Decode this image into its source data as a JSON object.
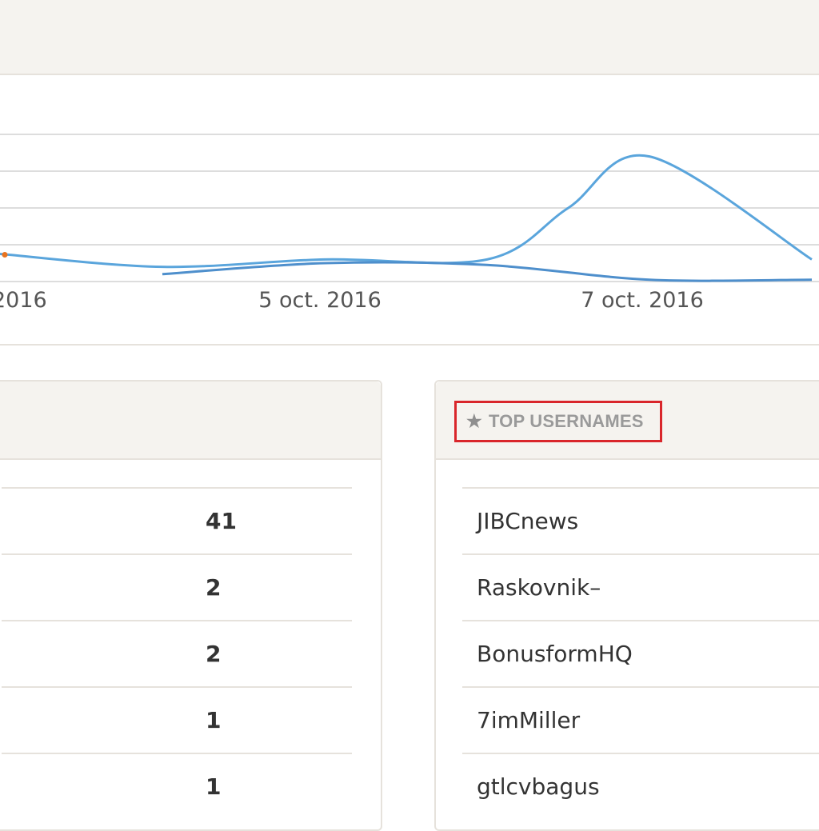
{
  "chart_data": {
    "type": "line",
    "x_tick_labels": [
      "2016",
      "5 oct. 2016",
      "7 oct. 2016"
    ],
    "series": [
      {
        "x": [
          "2016-10-03",
          "2016-10-04",
          "2016-10-05",
          "2016-10-06",
          "2016-10-06T12:00",
          "2016-10-07",
          "2016-10-08"
        ],
        "values": [
          0.75,
          0.4,
          0.6,
          0.6,
          2.0,
          3.4,
          0.6
        ],
        "color": "#5aa5dc"
      },
      {
        "x": [
          "2016-10-04",
          "2016-10-05",
          "2016-10-06",
          "2016-10-07",
          "2016-10-08"
        ],
        "values": [
          0.2,
          0.5,
          0.45,
          0.05,
          0.05
        ],
        "color": "#4e8fcc"
      }
    ],
    "marker_color": "#e8731f",
    "grid": true,
    "ylim": [
      0,
      4
    ]
  },
  "left_panel": {
    "rows": [
      {
        "count": "41"
      },
      {
        "count": "2"
      },
      {
        "count": "2"
      },
      {
        "count": "1"
      },
      {
        "count": "1"
      }
    ]
  },
  "right_panel": {
    "title": "TOP USERNAMES",
    "title_icon": "star-icon",
    "highlight_color": "#d9262b",
    "usernames": [
      "JIBCnews",
      "Raskovnik–",
      "BonusformHQ",
      "7imMiller",
      "gtlcvbagus"
    ]
  }
}
